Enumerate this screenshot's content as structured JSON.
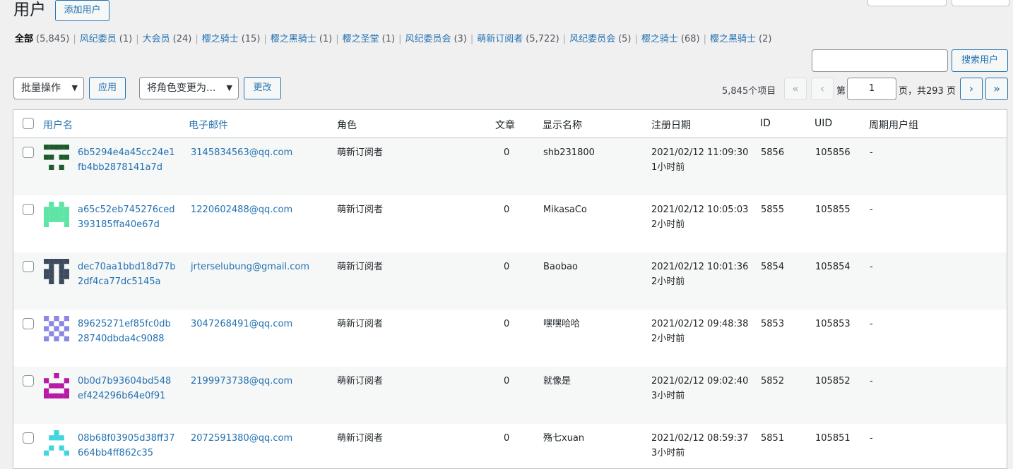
{
  "title": "用户",
  "add_button": "添加用户",
  "filters": [
    {
      "label": "全部",
      "count": "(5,845)",
      "current": true
    },
    {
      "label": "风纪委员",
      "count": "(1)"
    },
    {
      "label": "大会员",
      "count": "(24)"
    },
    {
      "label": "樱之骑士",
      "count": "(15)"
    },
    {
      "label": "樱之黑骑士",
      "count": "(1)"
    },
    {
      "label": "樱之圣堂",
      "count": "(1)"
    },
    {
      "label": "风纪委员会",
      "count": "(3)"
    },
    {
      "label": "萌新订阅者",
      "count": "(5,722)"
    },
    {
      "label": "风纪委员会",
      "count": "(5)"
    },
    {
      "label": "樱之骑士",
      "count": "(68)"
    },
    {
      "label": "樱之黑骑士",
      "count": "(2)"
    }
  ],
  "search": {
    "button": "搜索用户",
    "value": ""
  },
  "bulk": {
    "select": "批量操作",
    "apply": "应用"
  },
  "role_change": {
    "select": "将角色变更为...",
    "button": "更改"
  },
  "pagination": {
    "items": "5,845个项目",
    "first": "«",
    "prev": "‹",
    "next": "›",
    "last": "»",
    "page_prefix": "第",
    "current_page": "1",
    "page_suffix": "页，共293 页"
  },
  "columns": {
    "username": "用户名",
    "email": "电子邮件",
    "role": "角色",
    "posts": "文章",
    "display_name": "显示名称",
    "registered": "注册日期",
    "id": "ID",
    "uid": "UID",
    "group": "周期用户组"
  },
  "users": [
    {
      "username": "6b5294e4a45cc24e1fb4bb2878141a7d",
      "email": "3145834563@qq.com",
      "role": "萌新订阅者",
      "posts": "0",
      "display": "shb231800",
      "date": "2021/02/12 11:09:30",
      "ago": "1小时前",
      "id": "5856",
      "uid": "105856",
      "group": "-",
      "avatar_color": "#1e5b2b",
      "avatar_icon": "identicon"
    },
    {
      "username": "a65c52eb745276ced393185ffa40e67d",
      "email": "1220602488@qq.com",
      "role": "萌新订阅者",
      "posts": "0",
      "display": "MikasaCo",
      "date": "2021/02/12 10:05:03",
      "ago": "2小时前",
      "id": "5855",
      "uid": "105855",
      "group": "-",
      "avatar_color": "#5ee4a4",
      "avatar_icon": "identicon"
    },
    {
      "username": "dec70aa1bbd18d77b2df4ca77dc5145a",
      "email": "jrterselubung@gmail.com",
      "role": "萌新订阅者",
      "posts": "0",
      "display": "Baobao",
      "date": "2021/02/12 10:01:36",
      "ago": "2小时前",
      "id": "5854",
      "uid": "105854",
      "group": "-",
      "avatar_color": "#3d4a5e",
      "avatar_icon": "identicon"
    },
    {
      "username": "89625271ef85fc0db28740dbda4c9088",
      "email": "3047268491@qq.com",
      "role": "萌新订阅者",
      "posts": "0",
      "display": "嘿嘿哈哈",
      "date": "2021/02/12 09:48:38",
      "ago": "2小时前",
      "id": "5853",
      "uid": "105853",
      "group": "-",
      "avatar_color": "#8b88e4",
      "avatar_icon": "identicon"
    },
    {
      "username": "0b0d7b93604bd548ef424296b64e0f91",
      "email": "2199973738@qq.com",
      "role": "萌新订阅者",
      "posts": "0",
      "display": "就像是",
      "date": "2021/02/12 09:02:40",
      "ago": "3小时前",
      "id": "5852",
      "uid": "105852",
      "group": "-",
      "avatar_color": "#b81aa6",
      "avatar_icon": "identicon"
    },
    {
      "username": "08b68f03905d38ff37664bb4ff862c35",
      "email": "2072591380@qq.com",
      "role": "萌新订阅者",
      "posts": "0",
      "display": "殇七xuan",
      "date": "2021/02/12 08:59:37",
      "ago": "3小时前",
      "id": "5851",
      "uid": "105851",
      "group": "-",
      "avatar_color": "#3fd6e0",
      "avatar_icon": "identicon"
    }
  ]
}
